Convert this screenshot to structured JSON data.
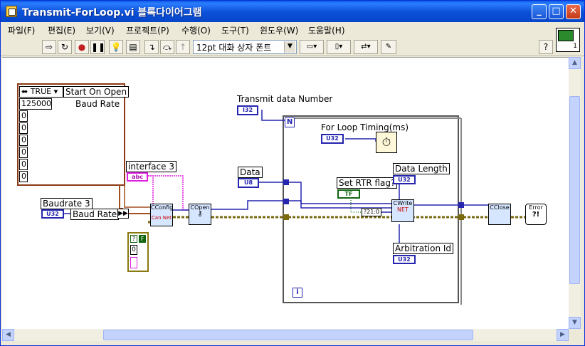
{
  "window": {
    "title": "Transmit-ForLoop.vi 블록다이어그램",
    "min_label": "_",
    "max_label": "□",
    "close_label": "✕"
  },
  "menu": [
    {
      "label": "파일(F)"
    },
    {
      "label": "편집(E)"
    },
    {
      "label": "보기(V)"
    },
    {
      "label": "프로젝트(P)"
    },
    {
      "label": "수행(O)"
    },
    {
      "label": "도구(T)"
    },
    {
      "label": "윈도우(W)"
    },
    {
      "label": "도움말(H)"
    }
  ],
  "toolbar": {
    "font_select": "12pt 대화 상자 폰트",
    "help_label": "?",
    "vi_icon_number": "1",
    "icons": [
      "run-arrow",
      "run-continuous",
      "abort",
      "pause",
      "highlight-execution",
      "retain-wire-values",
      "step-into",
      "step-over",
      "step-out",
      "align",
      "distribute",
      "reorder",
      "clean-up"
    ]
  },
  "diagram": {
    "array_constant": {
      "selector": "TRUE",
      "items": [
        "125000",
        "0",
        "0",
        "0",
        "0",
        "0",
        "0"
      ],
      "start_label": "Start On Open",
      "baud_label": "Baud Rate"
    },
    "transmit_label": "Transmit data Number",
    "transmit_type": "I32",
    "loop_count": "N",
    "loop_iteration": "i",
    "for_loop_timing_label": "For Loop Timing(ms)",
    "for_loop_timing_type": "U32",
    "interface_label": "interface 3",
    "interface_type": "abc",
    "data_label": "Data",
    "data_type": "U8",
    "set_rtr_label": "Set RTR flag?",
    "set_rtr_type": "TF",
    "data_length_label": "Data Length",
    "data_length_type": "U32",
    "arbitration_label": "Arbitration Id",
    "arbitration_type": "U32",
    "baudrate_label": "Baudrate 3",
    "baudrate_type": "U32",
    "baudrate_bundle_label": "Baud Rate",
    "cconfig_label": "CConfig",
    "cconfig_sub": "Can Net",
    "copen_label": "COpen",
    "cwrite_label": "CWrite",
    "cwrite_sub": "NET",
    "cclose_label": "CClose",
    "error_label": "Error",
    "error_sub": "?!",
    "convert_label": "?21:0",
    "cluster_const": {
      "q": "?",
      "f": "F",
      "num": "0"
    }
  }
}
